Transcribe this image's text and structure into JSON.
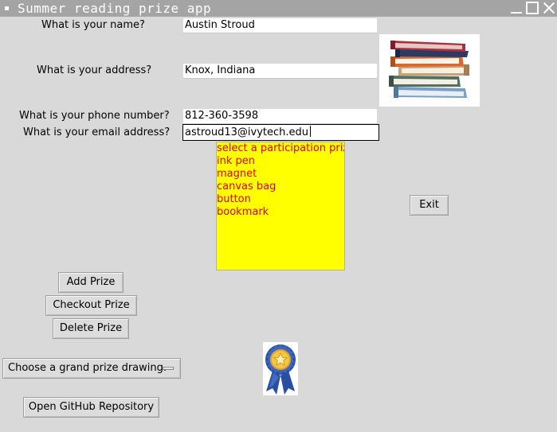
{
  "window": {
    "title": "Summer reading prize app"
  },
  "form": {
    "name_label": "What is your name?",
    "name_value": "Austin Stroud",
    "address_label": "What is your address?",
    "address_value": "Knox, Indiana",
    "phone_label": "What is your phone number?",
    "phone_value": "812-360-3598",
    "email_label": "What is your email address?",
    "email_value": "astroud13@ivytech.edu"
  },
  "prizes": {
    "items": [
      "select a participation prize",
      "ink pen",
      "magnet",
      "canvas bag",
      "button",
      "bookmark"
    ],
    "background": "#ffff00",
    "text_color": "#e0001b"
  },
  "buttons": {
    "exit": "Exit",
    "add_prize": "Add Prize",
    "checkout_prize": "Checkout Prize",
    "delete_prize": "Delete Prize",
    "open_github": "Open GitHub Repository"
  },
  "grand_prize": {
    "selected": "Choose a grand prize drawing."
  },
  "images": {
    "books": "stack-of-books-image",
    "ribbon": "award-ribbon-image"
  }
}
